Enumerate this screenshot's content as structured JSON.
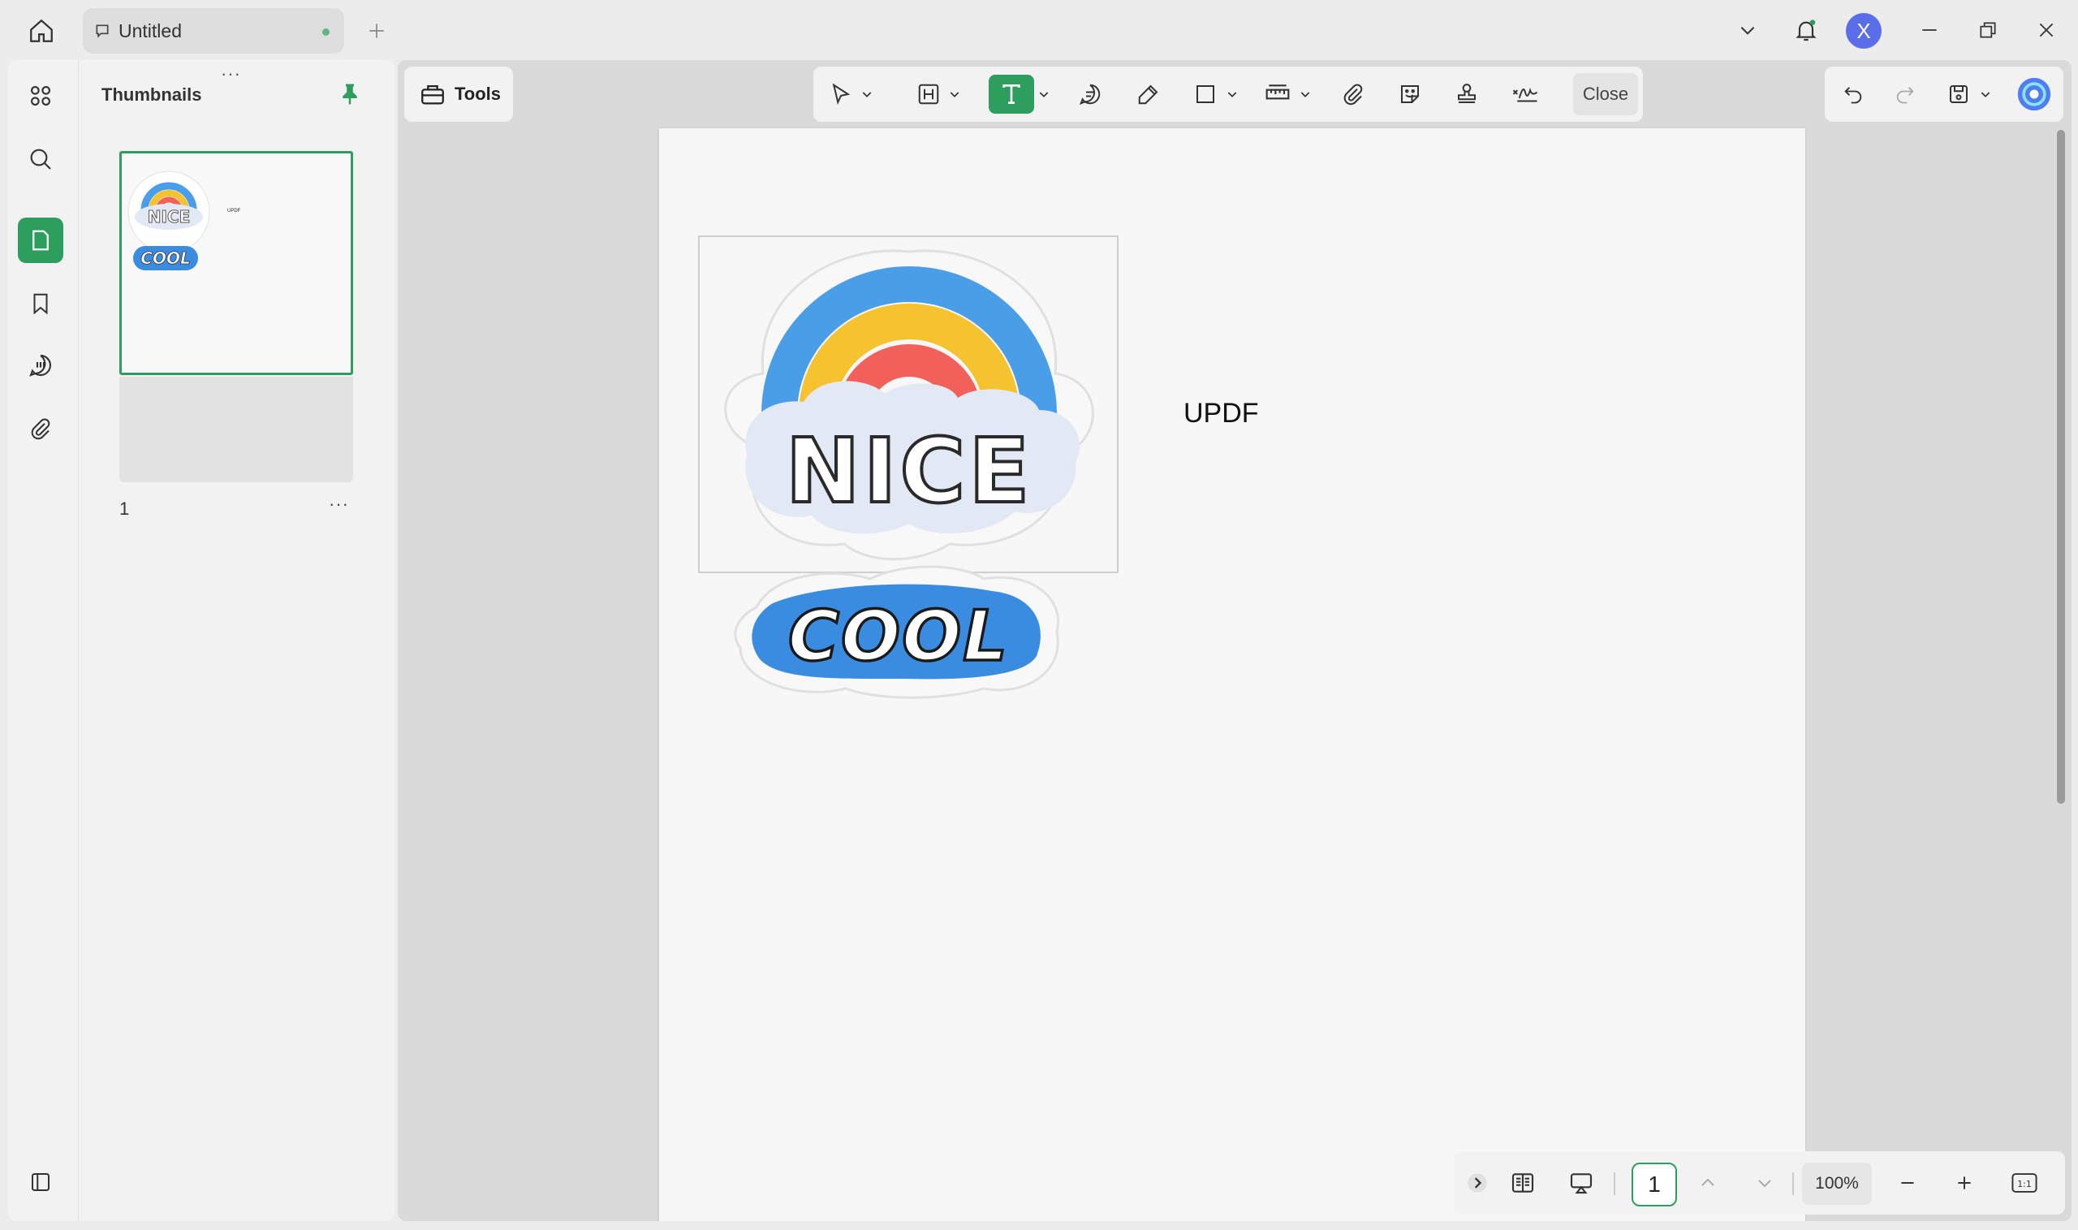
{
  "tab": {
    "title": "Untitled"
  },
  "account": {
    "initial": "X"
  },
  "sidebar": {
    "panel_title": "Thumbnails",
    "thumbnail": {
      "page_number": "1",
      "more": "···",
      "mini_text": "UPDF"
    }
  },
  "toolbar": {
    "tools_label": "Tools",
    "close_label": "Close",
    "active_tool": "text-tool"
  },
  "document": {
    "text_box": "UPDF",
    "stickers": [
      "NICE",
      "COOL"
    ]
  },
  "bottom": {
    "page_number": "1",
    "zoom": "100%",
    "fit_label": "1:1"
  },
  "colors": {
    "accent": "#2e9e5f",
    "avatar": "#5a6ee8",
    "rainbow_blue": "#4a9ee8",
    "rainbow_yellow": "#f5c330",
    "rainbow_red": "#f2605a",
    "cloud": "#e2e8f4",
    "cool_blue": "#3a8ce0"
  }
}
